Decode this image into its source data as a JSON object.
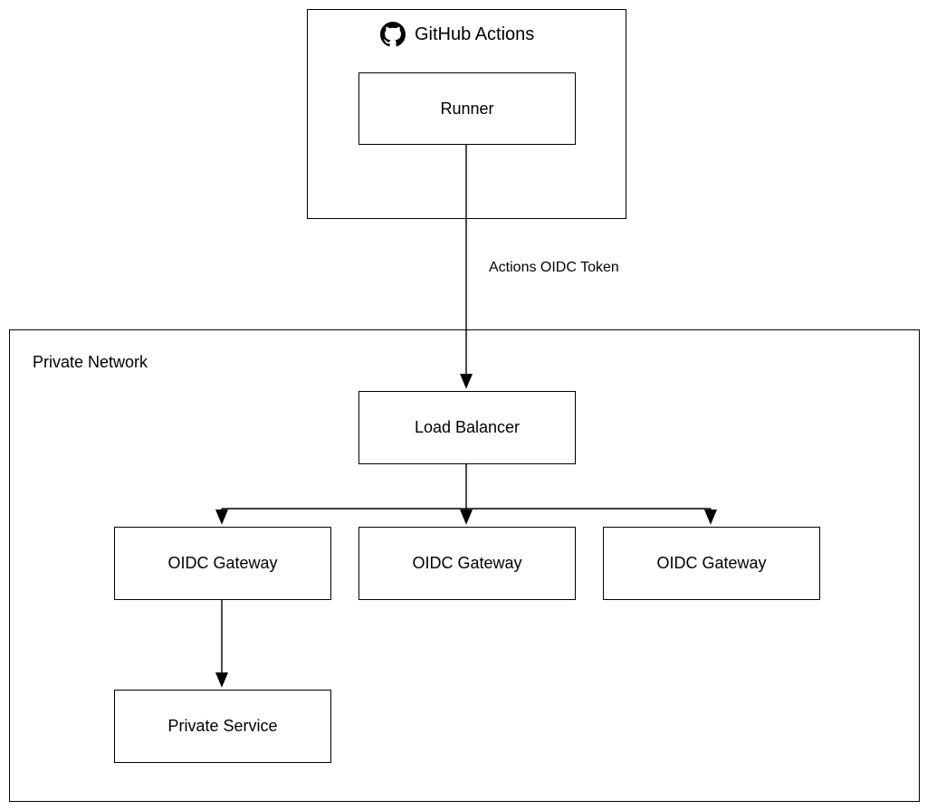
{
  "github_actions": {
    "title": "GitHub Actions",
    "runner_label": "Runner"
  },
  "connection": {
    "label": "Actions OIDC Token"
  },
  "private_network": {
    "title": "Private Network",
    "load_balancer_label": "Load Balancer",
    "oidc_gateways": [
      "OIDC Gateway",
      "OIDC Gateway",
      "OIDC Gateway"
    ],
    "private_service_label": "Private Service"
  }
}
